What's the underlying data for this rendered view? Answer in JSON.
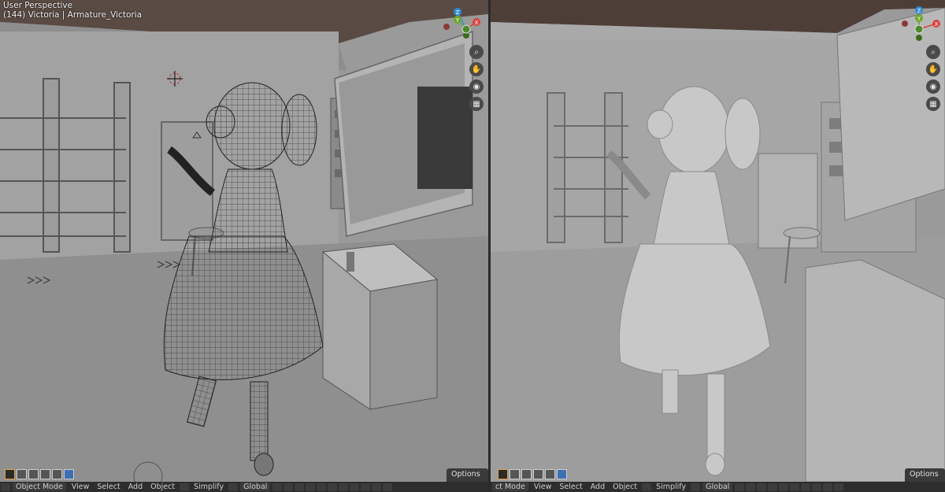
{
  "viewport_left": {
    "title": "User Perspective",
    "subtitle": "(144) Victoria | Armature_Victoria",
    "shading": "wireframe"
  },
  "viewport_right": {
    "shading": "solid"
  },
  "gizmo": {
    "z": "Z",
    "y": "Y",
    "x": "X"
  },
  "nav_icons": [
    "zoom-icon",
    "pan-hand-icon",
    "camera-icon",
    "grid-icon"
  ],
  "options_label": "Options",
  "footer_left": {
    "mode": "Object Mode",
    "menus": [
      "View",
      "Select",
      "Add",
      "Object"
    ],
    "simplify": "Simplify",
    "orientation": "Global"
  },
  "footer_right": {
    "mode": "ct Mode",
    "menus": [
      "View",
      "Select",
      "Add",
      "Object"
    ],
    "simplify": "Simplify",
    "orientation": "Global"
  },
  "colors": {
    "axis_x": "#d9443f",
    "axis_y": "#6ea72a",
    "axis_z": "#2f8bd6",
    "viewport_bg": "#9a9a9a",
    "header_bg": "#2d2d2d"
  }
}
